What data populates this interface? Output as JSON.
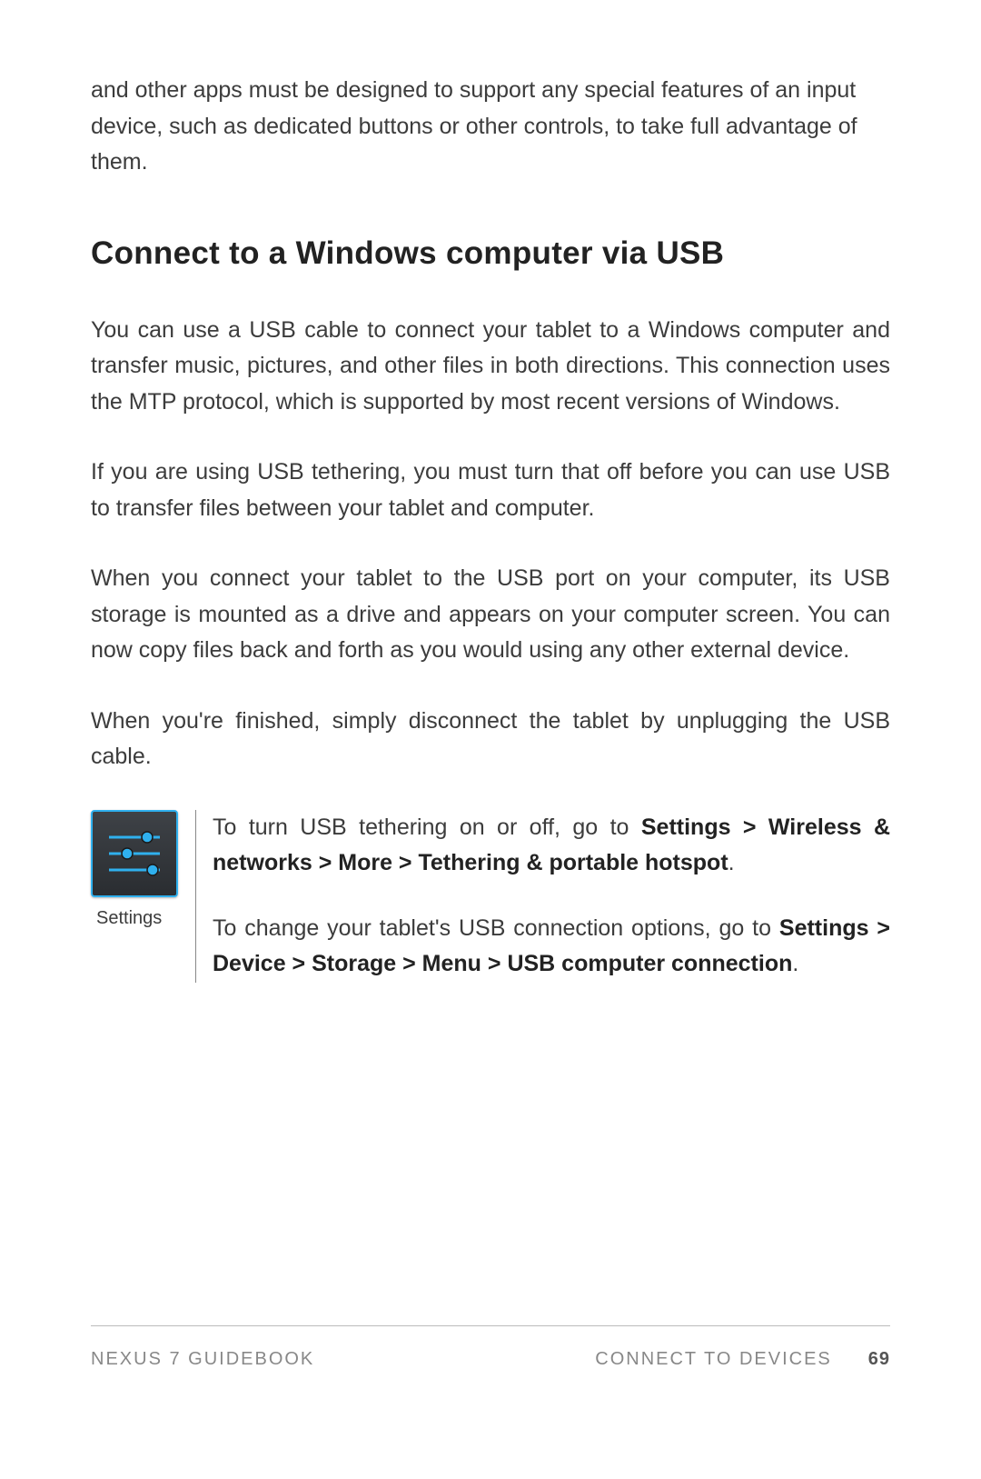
{
  "intro": "and other apps must be designed to support any special features of an input device, such as dedicated buttons or other controls, to take full advantage of them.",
  "heading": "Connect to a Windows computer via USB",
  "p1": "You can use a USB cable to connect your tablet to a Windows computer and transfer music, pictures, and other files in both directions. This connection uses the MTP protocol, which is supported by most recent versions of Windows.",
  "p2": "If you are using USB tethering, you must turn that off before you can use USB to transfer files between your tablet and computer.",
  "p3": "When you connect your tablet to the USB port on your computer, its USB storage is mounted as a drive and appears on your computer screen. You can now copy files back and forth as you would using any other external device.",
  "p4": "When you're finished, simply disconnect the tablet by unplugging the USB cable.",
  "icon_caption": "Settings",
  "tip1_pre": "To turn USB tethering on or off, go to ",
  "tip1_bold": "Settings > Wireless & networks > More > Tethering & portable hotspot",
  "tip1_post": ".",
  "tip2_pre": "To change your tablet's USB connection options, go to ",
  "tip2_bold": "Settings > Device > Storage > Menu > USB computer connection",
  "tip2_post": ".",
  "footer_left": "NEXUS 7 GUIDEBOOK",
  "footer_center": "CONNECT TO DEVICES",
  "page_number": "69"
}
